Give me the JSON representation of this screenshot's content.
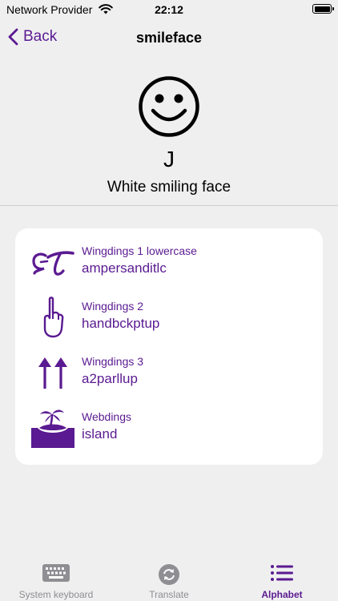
{
  "status_bar": {
    "carrier": "Network Provider",
    "time": "22:12"
  },
  "nav": {
    "back_label": "Back",
    "title": "smileface"
  },
  "glyph": {
    "char": "J",
    "name": "White smiling face"
  },
  "equivalents": [
    {
      "font": "Wingdings 1 lowercase",
      "name": "ampersanditlc",
      "icon": "ampersand-italic-icon"
    },
    {
      "font": "Wingdings 2",
      "name": "handbckptup",
      "icon": "hand-pointing-up-icon"
    },
    {
      "font": "Wingdings 3",
      "name": "a2parllup",
      "icon": "two-up-arrows-icon"
    },
    {
      "font": "Webdings",
      "name": "island",
      "icon": "island-icon"
    }
  ],
  "tabs": [
    {
      "label": "System keyboard",
      "icon": "keyboard-icon",
      "active": false
    },
    {
      "label": "Translate",
      "icon": "translate-icon",
      "active": false
    },
    {
      "label": "Alphabet",
      "icon": "list-icon",
      "active": true
    }
  ],
  "colors": {
    "accent": "#5a1a91",
    "background": "#efeff0",
    "card": "#ffffff",
    "inactive_tab": "#8e8e93"
  }
}
